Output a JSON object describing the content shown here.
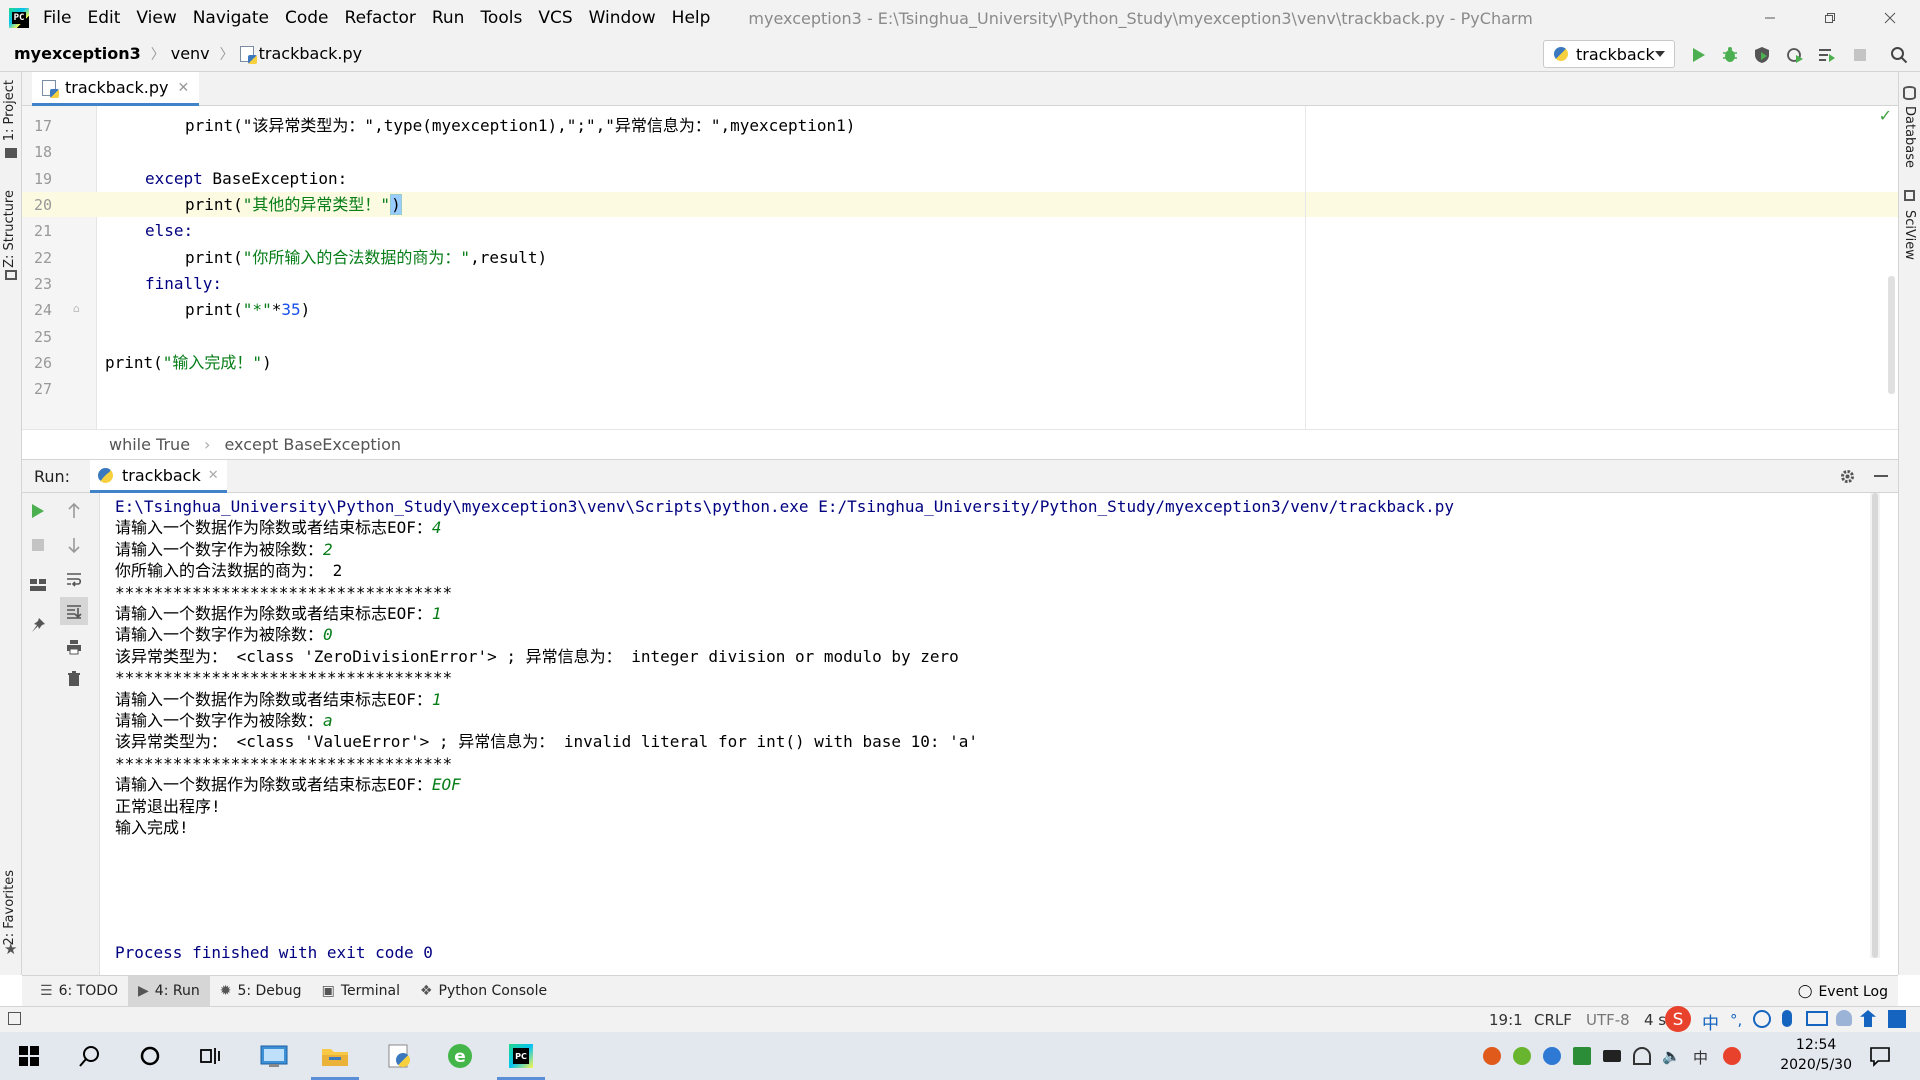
{
  "window": {
    "title": "myexception3 - E:\\Tsinghua_University\\Python_Study\\myexception3\\venv\\trackback.py - PyCharm",
    "menu": [
      "File",
      "Edit",
      "View",
      "Navigate",
      "Code",
      "Refactor",
      "Run",
      "Tools",
      "VCS",
      "Window",
      "Help"
    ]
  },
  "nav": {
    "project": "myexception3",
    "folder": "venv",
    "file": "trackback.py",
    "run_config": "trackback"
  },
  "editor": {
    "tab": "trackback.py",
    "line_numbers": [
      "17",
      "18",
      "19",
      "20",
      "21",
      "22",
      "23",
      "24",
      "25",
      "26",
      "27"
    ],
    "lines": {
      "l17": "print(\"该异常类型为：\",type(myexception1),\";\",\"异常信息为：\",myexception1)",
      "l19_kw": "except",
      "l19_rest": " BaseException:",
      "l20_a": "print(",
      "l20_str": "\"其他的异常类型！\"",
      "l20_b": ")",
      "l21": "else:",
      "l22_a": "print(",
      "l22_str": "\"你所输入的合法数据的商为：\"",
      "l22_b": ",result)",
      "l23": "finally:",
      "l24_a": "print(",
      "l24_str": "\"*\"",
      "l24_op": "*",
      "l24_num": "35",
      "l24_b": ")",
      "l26_a": "print(",
      "l26_str": "\"输入完成！\"",
      "l26_b": ")"
    }
  },
  "breadcrumbs": [
    "while True",
    "except BaseException"
  ],
  "run_panel": {
    "label": "Run:",
    "tab": "trackback"
  },
  "console": {
    "path_line": "E:\\Tsinghua_University\\Python_Study\\myexception3\\venv\\Scripts\\python.exe E:/Tsinghua_University/Python_Study/myexception3/venv/trackback.py",
    "lines": [
      {
        "text": "请输入一个数据作为除数或者结束标志EOF：",
        "input": "4"
      },
      {
        "text": "请输入一个数字作为被除数：",
        "input": "2"
      },
      {
        "text": "你所输入的合法数据的商为： 2",
        "input": ""
      },
      {
        "text": "***********************************",
        "input": ""
      },
      {
        "text": "请输入一个数据作为除数或者结束标志EOF：",
        "input": "1"
      },
      {
        "text": "请输入一个数字作为被除数：",
        "input": "0"
      },
      {
        "text": "该异常类型为： <class 'ZeroDivisionError'> ; 异常信息为： integer division or modulo by zero",
        "input": ""
      },
      {
        "text": "***********************************",
        "input": ""
      },
      {
        "text": "请输入一个数据作为除数或者结束标志EOF：",
        "input": "1"
      },
      {
        "text": "请输入一个数字作为被除数：",
        "input": "a"
      },
      {
        "text": "该异常类型为： <class 'ValueError'> ; 异常信息为： invalid literal for int() with base 10: 'a'",
        "input": ""
      },
      {
        "text": "***********************************",
        "input": ""
      },
      {
        "text": "请输入一个数据作为除数或者结束标志EOF：",
        "input": "EOF"
      },
      {
        "text": "正常退出程序!",
        "input": ""
      },
      {
        "text": "输入完成!",
        "input": ""
      }
    ],
    "exit_line": "Process finished with exit code 0"
  },
  "tool_windows": [
    {
      "label": "6: TODO"
    },
    {
      "label": "4: Run"
    },
    {
      "label": "5: Debug"
    },
    {
      "label": "Terminal"
    },
    {
      "label": "Python Console"
    }
  ],
  "event_log": "Event Log",
  "status": {
    "position": "19:1",
    "line_sep": "CRLF",
    "encoding": "UTF-8",
    "indent": "4 s"
  },
  "side_tabs": {
    "project": "1: Project",
    "structure": "Z: Structure",
    "favorites": "2: Favorites",
    "database": "Database",
    "sciview": "SciView"
  },
  "taskbar": {
    "time": "12:54",
    "date": "2020/5/30",
    "ime": "中"
  },
  "colors": {
    "accent": "#4083c9",
    "run_green": "#4caf50",
    "string_green": "#067d17",
    "keyword_navy": "#000080"
  }
}
